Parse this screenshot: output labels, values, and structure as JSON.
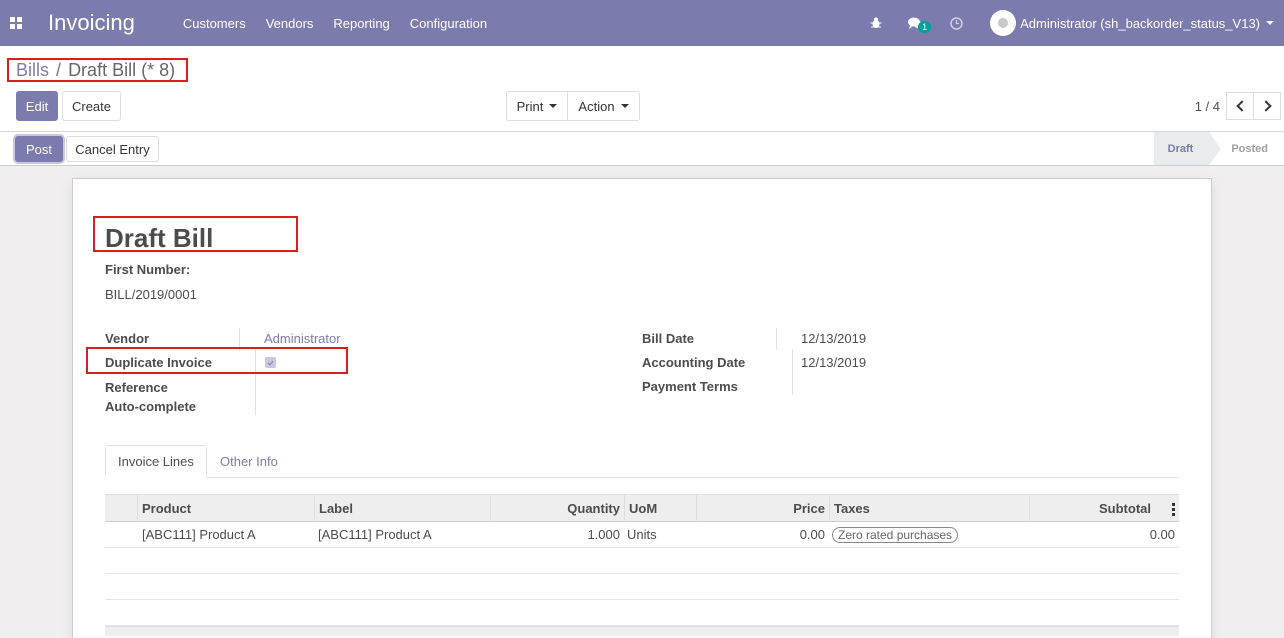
{
  "navbar": {
    "brand": "Invoicing",
    "menu": [
      "Customers",
      "Vendors",
      "Reporting",
      "Configuration"
    ],
    "messages_badge": "1",
    "user": "Administrator (sh_backorder_status_V13)"
  },
  "breadcrumb": {
    "parent": "Bills",
    "separator": "/",
    "current": "Draft Bill (* 8)"
  },
  "buttons": {
    "edit": "Edit",
    "create": "Create",
    "print": "Print",
    "action": "Action",
    "post": "Post",
    "cancel_entry": "Cancel Entry"
  },
  "pager": {
    "value": "1 / 4"
  },
  "status": {
    "steps": [
      "Draft",
      "Posted"
    ],
    "active": "Draft"
  },
  "form": {
    "title": "Draft Bill",
    "first_number_label": "First Number:",
    "first_number": "BILL/2019/0001",
    "vendor_label": "Vendor",
    "vendor": "Administrator",
    "duplicate_label": "Duplicate Invoice",
    "duplicate_checked": true,
    "reference_label": "Reference",
    "autocomplete_label": "Auto-complete",
    "bill_date_label": "Bill Date",
    "bill_date": "12/13/2019",
    "accounting_date_label": "Accounting Date",
    "accounting_date": "12/13/2019",
    "payment_terms_label": "Payment Terms"
  },
  "tabs": [
    "Invoice Lines",
    "Other Info"
  ],
  "table": {
    "headers": {
      "product": "Product",
      "label": "Label",
      "quantity": "Quantity",
      "uom": "UoM",
      "price": "Price",
      "taxes": "Taxes",
      "subtotal": "Subtotal"
    },
    "rows": [
      {
        "product": "[ABC111] Product A",
        "label": "[ABC111] Product A",
        "quantity": "1.000",
        "uom": "Units",
        "price": "0.00",
        "taxes": "Zero rated purchases",
        "subtotal": "0.00"
      }
    ]
  },
  "colors": {
    "primary": "#7c7bad",
    "highlight": "#d81e1e"
  }
}
